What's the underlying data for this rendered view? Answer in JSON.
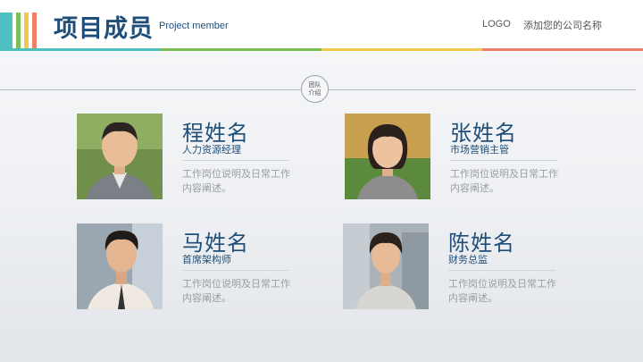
{
  "header": {
    "title": "项目成员",
    "subtitle": "Project member",
    "logo": "LOGO",
    "company": "添加您的公司名称",
    "stripe_colors": [
      "#4ec0c4",
      "#f2c84b",
      "#7dbf55",
      "#f07f68"
    ],
    "line_colors": [
      "#4ec0c4",
      "#7dbf55",
      "#f2c84b",
      "#f07f68"
    ]
  },
  "section": {
    "badge_line1": "团队",
    "badge_line2": "介绍"
  },
  "members": [
    {
      "name": "程姓名",
      "role": "人力资源经理",
      "description": "工作岗位说明及日常工作内容阐述。"
    },
    {
      "name": "张姓名",
      "role": "市场营销主管",
      "description": "工作岗位说明及日常工作内容阐述。"
    },
    {
      "name": "马姓名",
      "role": "首席架构师",
      "description": "工作岗位说明及日常工作内容阐述。"
    },
    {
      "name": "陈姓名",
      "role": "财务总监",
      "description": "工作岗位说明及日常工作内容阐述。"
    }
  ]
}
